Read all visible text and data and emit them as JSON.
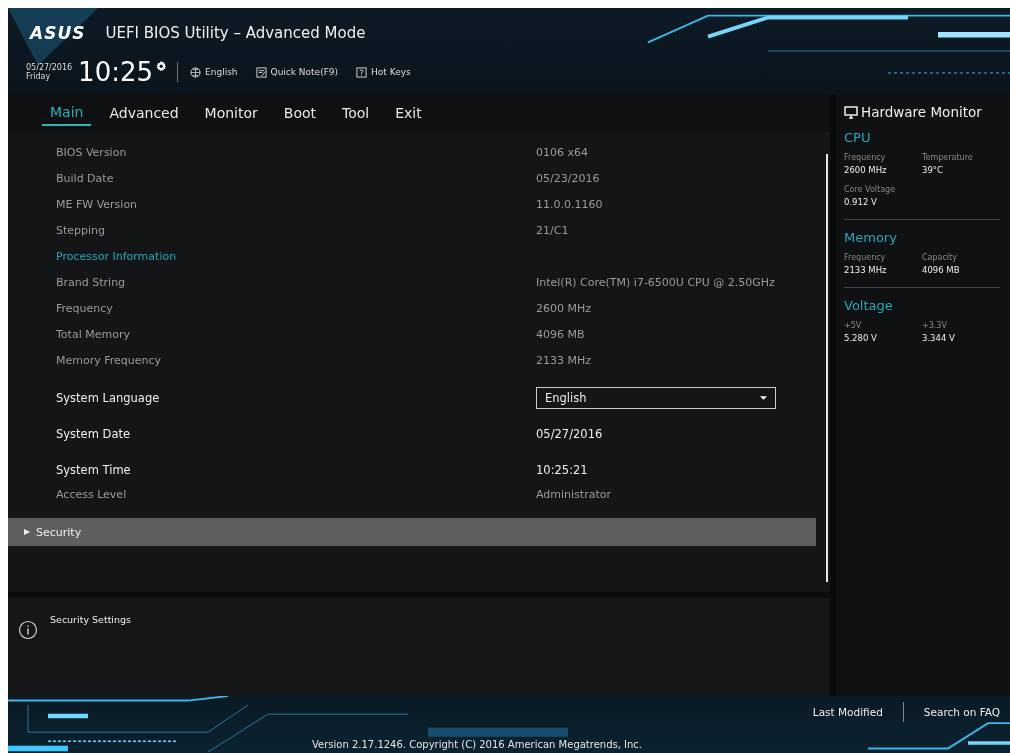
{
  "header": {
    "logo": "ASUS",
    "title": "UEFI BIOS Utility – Advanced Mode",
    "date": "05/27/2016",
    "day": "Friday",
    "time": "10:25",
    "language": "English",
    "quick_note": "Quick Note(F9)",
    "hot_keys": "Hot Keys"
  },
  "tabs": [
    {
      "label": "Main",
      "selected": true
    },
    {
      "label": "Advanced",
      "selected": false
    },
    {
      "label": "Monitor",
      "selected": false
    },
    {
      "label": "Boot",
      "selected": false
    },
    {
      "label": "Tool",
      "selected": false
    },
    {
      "label": "Exit",
      "selected": false
    }
  ],
  "rows": [
    {
      "kind": "info",
      "label": "BIOS Version",
      "value": "0106 x64"
    },
    {
      "kind": "info",
      "label": "Build Date",
      "value": "05/23/2016"
    },
    {
      "kind": "info",
      "label": "ME FW Version",
      "value": "11.0.0.1160"
    },
    {
      "kind": "info",
      "label": "Stepping",
      "value": "21/C1"
    },
    {
      "kind": "section",
      "label": "Processor Information"
    },
    {
      "kind": "info",
      "label": "Brand String",
      "value": "Intel(R) Core(TM) i7-6500U CPU @ 2.50GHz"
    },
    {
      "kind": "info",
      "label": "Frequency",
      "value": "2600 MHz"
    },
    {
      "kind": "info",
      "label": "Total Memory",
      "value": "4096 MB"
    },
    {
      "kind": "info",
      "label": "Memory Frequency",
      "value": "2133 MHz"
    },
    {
      "kind": "dropdown",
      "label": "System Language",
      "value": "English"
    },
    {
      "kind": "setting",
      "label": "System Date",
      "value": "05/27/2016"
    },
    {
      "kind": "setting",
      "label": "System Time",
      "value": "10:25:21"
    },
    {
      "kind": "info",
      "label": "Access Level",
      "value": "Administrator"
    },
    {
      "kind": "submenu",
      "label": "Security",
      "selected": true
    }
  ],
  "help": {
    "text": "Security Settings"
  },
  "hardware_monitor": {
    "title": "Hardware Monitor",
    "sections": [
      {
        "title": "CPU",
        "fields": [
          {
            "label": "Frequency",
            "value": "2600 MHz"
          },
          {
            "label": "Temperature",
            "value": "39°C"
          },
          {
            "label": "Core Voltage",
            "value": "0.912 V"
          }
        ]
      },
      {
        "title": "Memory",
        "fields": [
          {
            "label": "Frequency",
            "value": "2133 MHz"
          },
          {
            "label": "Capacity",
            "value": "4096 MB"
          }
        ]
      },
      {
        "title": "Voltage",
        "fields": [
          {
            "label": "+5V",
            "value": "5.280 V"
          },
          {
            "label": "+3.3V",
            "value": "3.344 V"
          }
        ]
      }
    ]
  },
  "footer": {
    "version": "Version 2.17.1246. Copyright (C) 2016 American Megatrends, Inc.",
    "last_modified": "Last Modified",
    "search_faq": "Search on FAQ"
  }
}
